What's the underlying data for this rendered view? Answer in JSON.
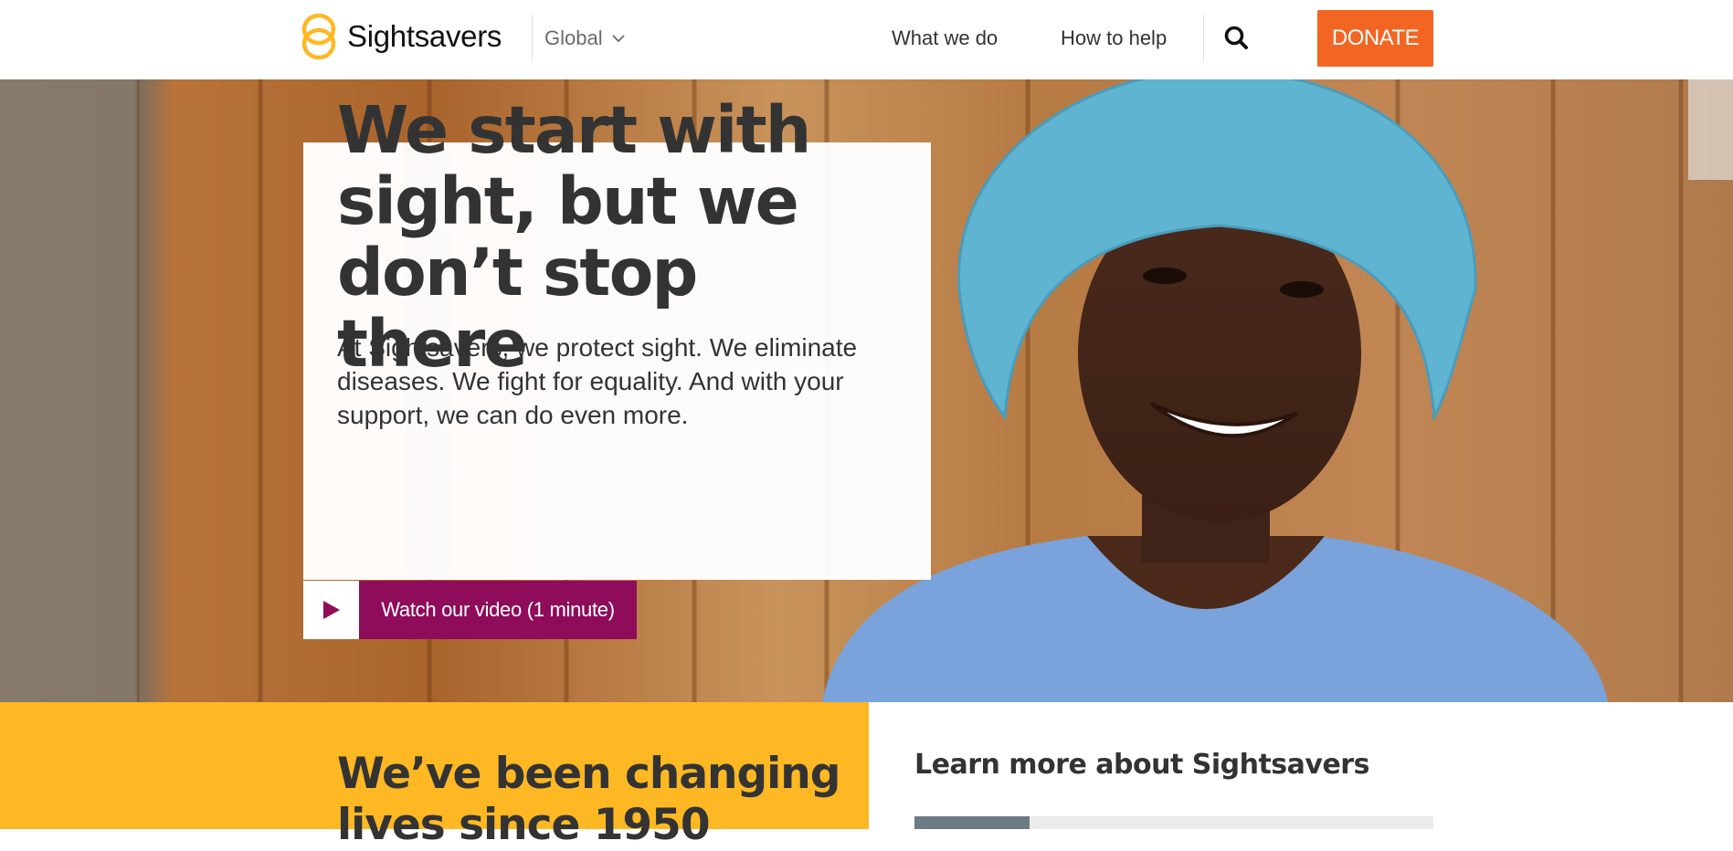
{
  "header": {
    "logo_text": "Sightsavers",
    "region_label": "Global",
    "nav": [
      "What we do",
      "How to help"
    ],
    "donate_label": "DONATE"
  },
  "hero": {
    "title": "We start with sight, but we don’t stop there",
    "text": "At Sightsavers, we protect sight. We eliminate diseases. We fight for equality. And with your support, we can do even more.",
    "video_label": "Watch our video (1 minute)"
  },
  "history": {
    "heading": "We’ve been changing lives since 1950"
  },
  "learn": {
    "heading": "Learn more about Sightsavers"
  },
  "colors": {
    "brand_yellow": "#fdb823",
    "donate_orange": "#f26522",
    "video_magenta": "#8f0c5a"
  },
  "icons": [
    "sightsavers-logo-icon",
    "chevron-down-icon",
    "search-icon",
    "play-icon"
  ]
}
